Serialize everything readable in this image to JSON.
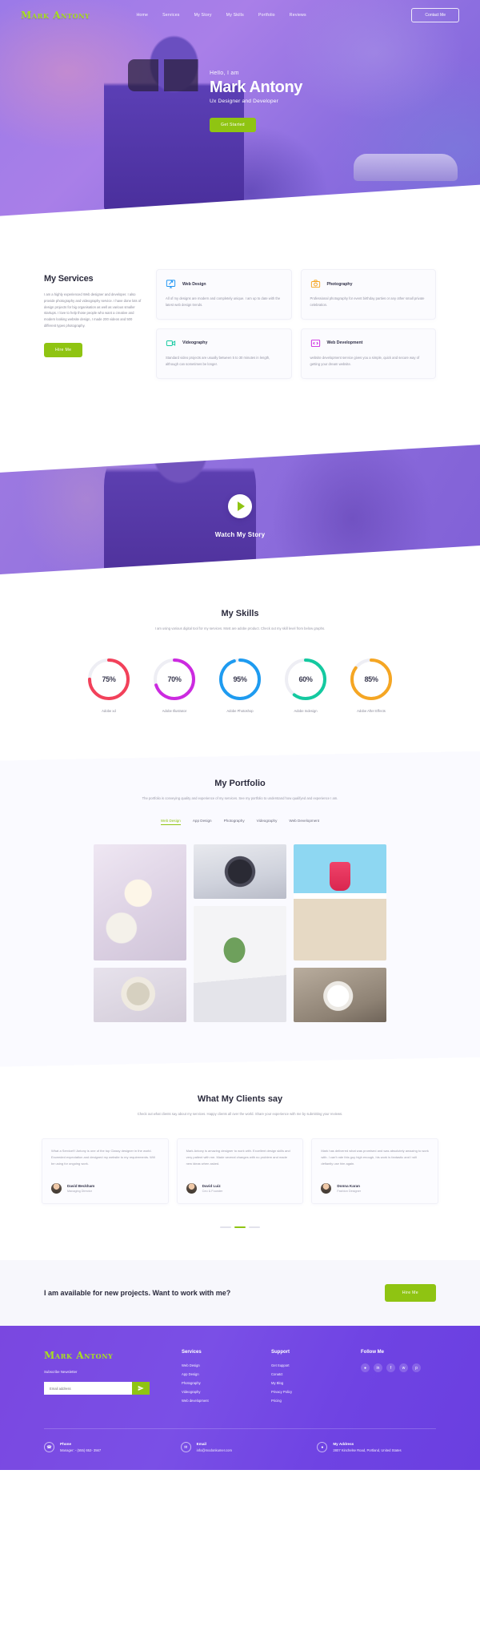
{
  "brand": "Mark Antony",
  "nav": {
    "items": [
      "Home",
      "Services",
      "My Story",
      "My Skills",
      "Portfolio",
      "Reviews"
    ],
    "contact_label": "Contact Me"
  },
  "hero": {
    "hello": "Hello, I am",
    "name": "Mark Antony",
    "role": "Ux Designer and Developer",
    "cta": "Get Started"
  },
  "services": {
    "title": "My Services",
    "paragraph": "I am a highly experienced Web designer and developer. I also provide photography and videography service. I have done lots of design projects for big organisation as well as various smaller startups. I love to help those people who want a creative and modern looking website design, I made 200 videos and 500 different types photography.",
    "cta": "Hire Me",
    "cards": [
      {
        "icon": "monitor-icon",
        "title": "Web Design",
        "text": "All of my designs are modern and completely unique. I am up to date with the latest web design trends."
      },
      {
        "icon": "camera-icon",
        "title": "Photography",
        "text": "Professional photography for event birthday parties or any other small private celebration."
      },
      {
        "icon": "video-icon",
        "title": "Videography",
        "text": "Standard video projects are usually between 5 to 30 minutes in length, although can sometimes be longer."
      },
      {
        "icon": "code-icon",
        "title": "Web Development",
        "text": "website development service gives you a simple, quick and secure way of getting your dream website."
      }
    ]
  },
  "story": {
    "label": "Watch My Story",
    "play_icon": "play-icon"
  },
  "skills": {
    "title": "My Skills",
    "subtitle": "I am using various digital tool for my services. Most are adobe product. Check out my skill level from below graphs."
  },
  "chart_data": {
    "type": "bar",
    "title": "My Skills",
    "categories": [
      "Adobe xd",
      "Adobe Illustrator",
      "Adobe Photoshop",
      "Adobe Indesign",
      "Adobe After Effects"
    ],
    "values": [
      75,
      70,
      95,
      60,
      85
    ],
    "value_labels": [
      "75%",
      "70%",
      "95%",
      "60%",
      "85%"
    ],
    "colors": [
      "#f2415a",
      "#cc2ae0",
      "#1e9bf0",
      "#14c9a0",
      "#f5a623"
    ],
    "ylim": [
      0,
      100
    ],
    "xlabel": "",
    "ylabel": "",
    "legend": "none",
    "grid": false
  },
  "portfolio": {
    "title": "My Portfolio",
    "subtitle": "The portfolio is conveying quality and experience of my services. See my portfolio to understand how qualifyed and experience I am.",
    "filters": [
      "Web Design",
      "App Design",
      "Photography",
      "Videography",
      "Web Development"
    ],
    "active_filter": "Web Design",
    "items": [
      "tea-cup-flatlay-thumb",
      "wristwatch-thumb",
      "beach-drink-thumb",
      "watch-macro-thumb",
      "plant-notebook-thumb",
      "coffee-cup-thumb"
    ]
  },
  "reviews": {
    "title": "What My Clients say",
    "subtitle": "Check out what clients say about my services. Happy clients all over the world. Share your experience with me by submitting your reviews.",
    "cards": [
      {
        "text": "What a Service!!! Antony is one of the top Classy designer in the world. Exceeded expectation and designed my website to my requirements. Will be using for ongoing work.",
        "name": "David Beckham",
        "role": "Managing Director"
      },
      {
        "text": "Mark Antony is amazing designer to work with. Excellent design skills and very patient with me. Made several changes with no problem and made new ideas when asked.",
        "name": "David Luiz",
        "role": "Ceo & Founder"
      },
      {
        "text": "Mark has delivered what was promised and was absolutely amazing to work with. I can't rate this guy high enough, his work is fantastic and I will defiantly use him again.",
        "name": "Donna Karan",
        "role": "Fashion Designer"
      }
    ],
    "dot_count": 3,
    "active_dot": 1
  },
  "cta": {
    "heading": "I am available for new projects. Want to work with me?",
    "button": "Hire Me"
  },
  "footer": {
    "brand": "Mark Antony",
    "subscribe_label": "Subscribe Newsletter",
    "email_placeholder": "Email address",
    "email_value": "",
    "send_icon": "send-icon",
    "columns": [
      {
        "heading": "Services",
        "links": [
          "Web Design",
          "App Design",
          "Photography",
          "Videography",
          "Web development"
        ]
      },
      {
        "heading": "Support",
        "links": [
          "Get Support",
          "Conatct",
          "My Blog",
          "Privacy Policy",
          "Pricing"
        ]
      }
    ],
    "follow_heading": "Follow Me",
    "socials": [
      "dribbble-icon",
      "linkedin-icon",
      "facebook-icon",
      "twitter-icon",
      "pinterest-icon"
    ],
    "contacts": [
      {
        "icon": "phone-icon",
        "title": "Phone",
        "value": "Manager: - (555) 652- 3567"
      },
      {
        "icon": "mail-icon",
        "title": "Email",
        "value": "info@modonkumer.com"
      },
      {
        "icon": "location-icon",
        "title": "My Address",
        "value": "2807 Kinchelse Road, Portland, United States"
      }
    ]
  }
}
